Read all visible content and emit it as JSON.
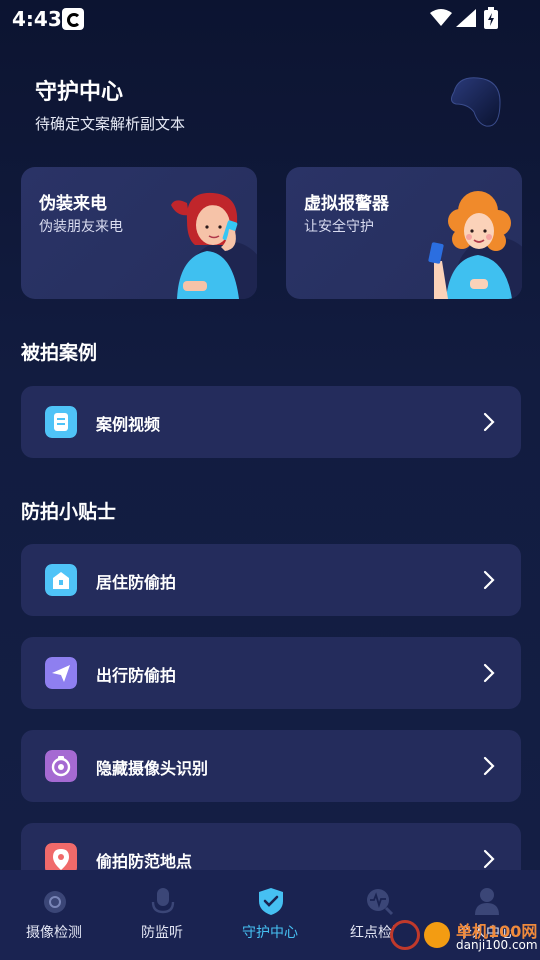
{
  "status_bar": {
    "time": "4:43",
    "icons": [
      "notification-app-icon",
      "wifi-icon",
      "signal-icon",
      "battery-charging-icon"
    ]
  },
  "header": {
    "title": "守护中心",
    "subtitle": "待确定文案解析副文本"
  },
  "feature_cards": [
    {
      "title": "伪装来电",
      "subtitle": "伪装朋友来电",
      "illustration": "girl-on-phone"
    },
    {
      "title": "虚拟报警器",
      "subtitle": "让安全守护",
      "illustration": "woman-with-phone"
    }
  ],
  "sections": {
    "cases": {
      "title": "被拍案例",
      "items": [
        {
          "label": "案例视频",
          "icon": "video-doc-icon",
          "icon_color": "#4fc3f7"
        }
      ]
    },
    "tips": {
      "title": "防拍小贴士",
      "items": [
        {
          "label": "居住防偷拍",
          "icon": "home-icon",
          "icon_color": "#4fc3f7"
        },
        {
          "label": "出行防偷拍",
          "icon": "paper-plane-icon",
          "icon_color": "#8e7ff0"
        },
        {
          "label": "隐藏摄像头识别",
          "icon": "camera-lens-icon",
          "icon_color": "#a56ad2"
        },
        {
          "label": "偷拍防范地点",
          "icon": "location-pin-icon",
          "icon_color": "#f06a6a"
        }
      ]
    }
  },
  "bottom_nav": {
    "items": [
      {
        "label": "摄像检测",
        "icon": "camera-detect-icon",
        "active": false
      },
      {
        "label": "防监听",
        "icon": "microphone-icon",
        "active": false
      },
      {
        "label": "守护中心",
        "icon": "shield-check-icon",
        "active": true
      },
      {
        "label": "红点检测",
        "icon": "pulse-search-icon",
        "active": false
      },
      {
        "label": "个人中心",
        "icon": "user-icon",
        "active": false
      }
    ]
  },
  "watermark": {
    "text": "单机100网",
    "url": "danji100.com"
  },
  "colors": {
    "background": "#0f1836",
    "card": "#242c5c",
    "accent": "#46c0f2"
  }
}
